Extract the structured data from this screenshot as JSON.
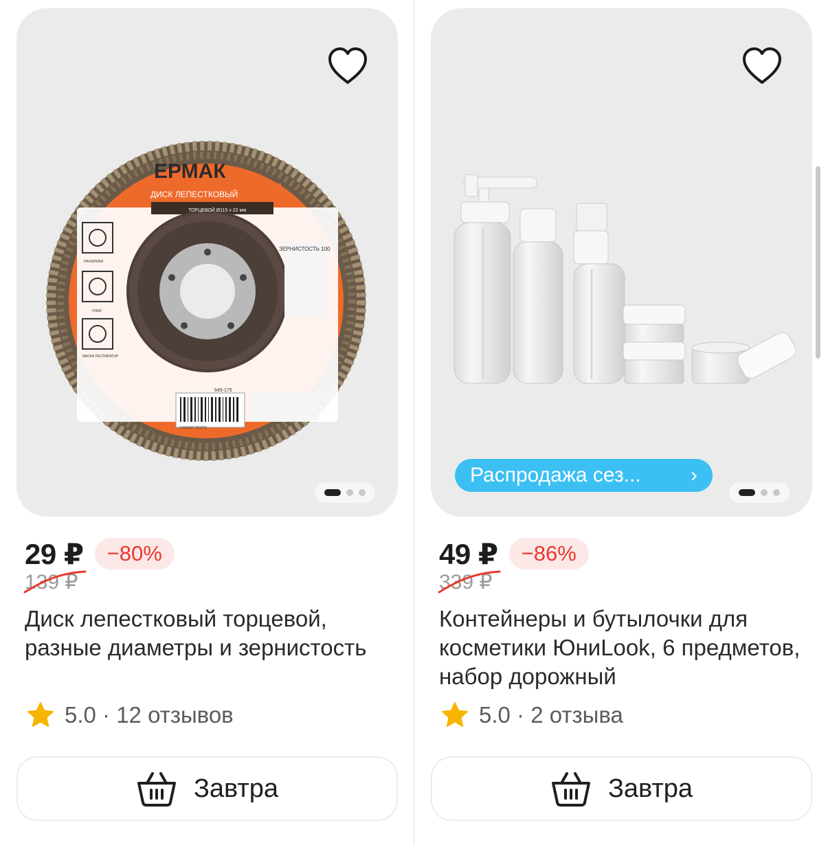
{
  "products": [
    {
      "price": "29 ₽",
      "discount": "−80%",
      "old_price": "139 ₽",
      "title": "Диск лепестковый торцевой, разные диаметры и зернистость",
      "rating": "5.0 · 12 отзывов",
      "cart_label": "Завтра",
      "image_text": {
        "brand": "ЕРМАК",
        "band": "ДИСК ЛЕПЕСТКОВЫЙ",
        "subband": "ТОРЦЕВОЙ Ø115 x 22 мм",
        "grit": "ЗЕРНИСТОСТЬ 100",
        "code": "645-175",
        "icon1": "НАУШНИКИ",
        "icon2": "ОЧКИ",
        "icon3": "МАСКА РЕСПИРАТОР",
        "barcode": "4 603347 061271"
      },
      "slide_count": 3,
      "active_slide": 1
    },
    {
      "price": "49 ₽",
      "discount": "−86%",
      "old_price": "339 ₽",
      "title": "Контейнеры и бутылочки для косметики ЮниLook, 6 предметов, набор дорожный",
      "rating": "5.0 · 2 отзыва",
      "cart_label": "Завтра",
      "sale_badge": "Распродажа сез...",
      "slide_count": 3,
      "active_slide": 1
    }
  ],
  "colors": {
    "accent_blue": "#3cc0f3",
    "discount_red": "#e8392c",
    "discount_bg": "#fde8e8",
    "star": "#f7b500",
    "card_bg": "#ebebeb"
  },
  "icons": [
    "heart-icon",
    "star-icon",
    "basket-icon",
    "chevron-right-icon"
  ]
}
